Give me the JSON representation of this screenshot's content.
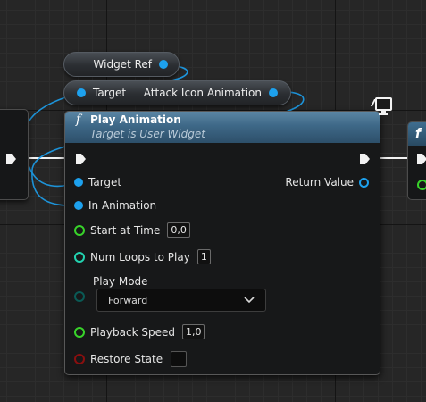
{
  "pills": {
    "widget_ref": "Widget Ref",
    "target": "Target",
    "attack_icon_animation": "Attack Icon Animation"
  },
  "node": {
    "function_glyph": "f",
    "title": "Play Animation",
    "subtitle": "Target is User Widget",
    "pins": {
      "target": "Target",
      "in_animation": "In Animation",
      "start_at_time": "Start at Time",
      "start_at_time_value": "0,0",
      "num_loops": "Num Loops to Play",
      "num_loops_value": "1",
      "play_mode": "Play Mode",
      "play_mode_value": "Forward",
      "playback_speed": "Playback Speed",
      "playback_speed_value": "1,0",
      "restore_state": "Restore State",
      "return_value": "Return Value"
    }
  },
  "right_node": {
    "function_glyph": "f"
  },
  "colors": {
    "object_pin": "#1da1ee",
    "float_pin": "#38d32a",
    "int_pin": "#22d3b0",
    "enum_pin": "#0a5a55",
    "bool_pin": "#8a0f0f",
    "header": "#3e6887"
  }
}
